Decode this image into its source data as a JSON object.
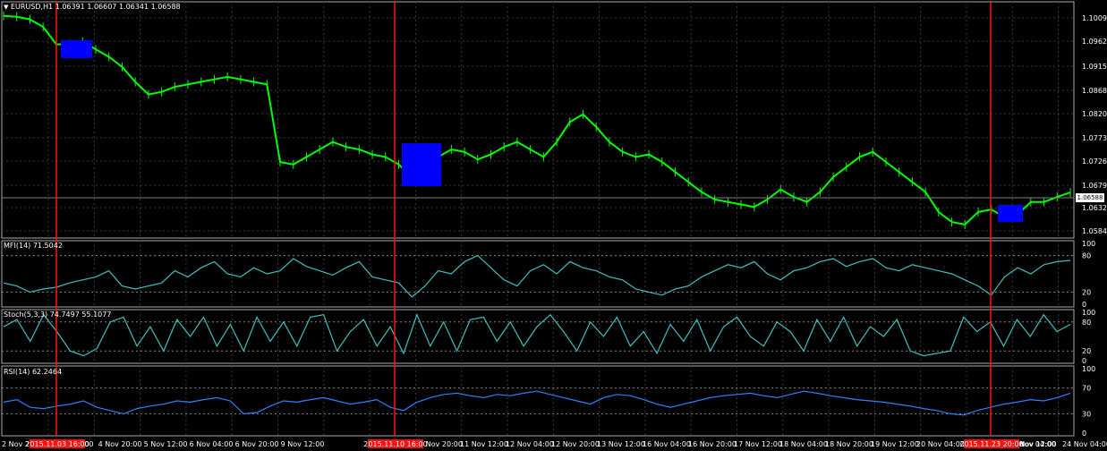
{
  "header": {
    "main": "EURUSD,H1  1.06391 1.06607 1.06341 1.06588",
    "mfi": "MFI(14) 71.5042",
    "stoch": "Stoch(5,3,3) 74.7497 55.1077",
    "rsi": "RSI(14) 62.2464"
  },
  "price_axis": [
    "1.10090",
    "1.09620",
    "1.09150",
    "1.08680",
    "1.08200",
    "1.07730",
    "1.07260",
    "1.06790",
    "1.06320",
    "1.05840"
  ],
  "current_price": "1.06588",
  "mfi_axis": [
    "100",
    "80",
    "20",
    "0"
  ],
  "stoch_axis": [
    "100",
    "80",
    "20",
    "0"
  ],
  "rsi_axis": [
    "100",
    "70",
    "30",
    "0"
  ],
  "time_axis": [
    "2 Nov 20",
    "4 Nov 04:00",
    "4 Nov 20:00",
    "5 Nov 12:00",
    "6 Nov 04:00",
    "6 Nov 20:00",
    "9 Nov 12:00",
    "10 Nov 20:00",
    "11 Nov 12:00",
    "12 Nov 04:00",
    "12 Nov 20:00",
    "13 Nov 12:00",
    "16 Nov 04:00",
    "16 Nov 20:00",
    "17 Nov 12:00",
    "18 Nov 04:00",
    "18 Nov 20:00",
    "19 Nov 12:00",
    "20 Nov 04:00",
    "20 Nov 20:00",
    "23 Nov 04:00",
    "Nov 12:00",
    "24 Nov 04:00"
  ],
  "markers": [
    {
      "label": "2015.11.03 16:00"
    },
    {
      "label": "2015.11.10 16:00"
    },
    {
      "label": "2015.11.23 20:00"
    }
  ],
  "colors": {
    "background": "#000000",
    "grid": "#3a3a3a",
    "candles": "#00ff00",
    "mfi": "#40c0c0",
    "stoch": "#40c0c0",
    "rsi": "#3080ff",
    "marker": "#ff1010",
    "box": "#0000ff"
  },
  "chart_data": [
    {
      "type": "line",
      "series": [
        {
          "values": [
            1.1012,
            1.101,
            1.1005,
            1.099,
            1.0955,
            1.0955,
            1.096,
            1.0945,
            1.093,
            1.091,
            1.088,
            1.0855,
            1.086,
            1.087,
            1.0875,
            1.088,
            1.0885,
            1.089,
            1.0885,
            1.088,
            1.0875,
            1.072,
            1.0715,
            1.073,
            1.0745,
            1.076,
            1.075,
            1.0745,
            1.0735,
            1.073,
            1.0715,
            1.069,
            1.07,
            1.073,
            1.0745,
            1.074,
            1.0725,
            1.0735,
            1.075,
            1.076,
            1.0745,
            1.073,
            1.076,
            1.08,
            1.0815,
            1.079,
            1.076,
            1.074,
            1.073,
            1.0735,
            1.072,
            1.07,
            1.068,
            1.066,
            1.0645,
            1.064,
            1.0635,
            1.063,
            1.0645,
            1.0665,
            1.065,
            1.064,
            1.066,
            1.069,
            1.071,
            1.073,
            1.074,
            1.072,
            1.07,
            1.068,
            1.066,
            1.062,
            1.06,
            1.0595,
            1.062,
            1.0625,
            1.061,
            1.0615,
            1.064,
            1.064,
            1.065,
            1.0659
          ]
        }
      ],
      "ylim": [
        1.0568,
        1.104
      ]
    },
    {
      "type": "line",
      "series": [
        {
          "values": [
            35,
            30,
            20,
            25,
            28,
            35,
            40,
            45,
            55,
            30,
            25,
            30,
            35,
            55,
            45,
            60,
            70,
            50,
            45,
            60,
            50,
            55,
            75,
            62,
            55,
            48,
            60,
            70,
            45,
            40,
            35,
            12,
            30,
            55,
            50,
            70,
            80,
            60,
            40,
            30,
            55,
            65,
            50,
            70,
            60,
            55,
            45,
            40,
            25,
            20,
            15,
            25,
            30,
            45,
            55,
            65,
            60,
            70,
            50,
            40,
            55,
            60,
            70,
            75,
            62,
            70,
            75,
            60,
            55,
            65,
            60,
            55,
            50,
            40,
            30,
            15,
            45,
            60,
            50,
            65,
            70,
            72
          ]
        }
      ],
      "ylim": [
        0,
        100
      ]
    },
    {
      "type": "line",
      "series": [
        {
          "values": [
            70,
            85,
            40,
            95,
            60,
            20,
            10,
            25,
            80,
            90,
            30,
            70,
            20,
            85,
            50,
            90,
            30,
            75,
            20,
            90,
            40,
            80,
            30,
            90,
            95,
            20,
            60,
            85,
            30,
            70,
            15,
            95,
            30,
            80,
            20,
            85,
            90,
            40,
            80,
            30,
            70,
            95,
            60,
            20,
            80,
            50,
            90,
            30,
            60,
            15,
            75,
            40,
            85,
            20,
            70,
            90,
            50,
            30,
            80,
            60,
            20,
            85,
            40,
            90,
            30,
            70,
            50,
            85,
            20,
            10,
            15,
            20,
            90,
            60,
            80,
            30,
            85,
            50,
            95,
            60,
            75
          ]
        }
      ],
      "ylim": [
        0,
        100
      ]
    },
    {
      "type": "line",
      "series": [
        {
          "values": [
            48,
            52,
            40,
            38,
            42,
            45,
            50,
            40,
            35,
            30,
            38,
            42,
            45,
            50,
            48,
            52,
            55,
            50,
            30,
            32,
            42,
            50,
            48,
            52,
            55,
            50,
            45,
            48,
            52,
            40,
            35,
            48,
            55,
            60,
            62,
            58,
            55,
            60,
            58,
            62,
            65,
            60,
            55,
            50,
            45,
            55,
            60,
            58,
            52,
            45,
            40,
            45,
            50,
            55,
            58,
            60,
            62,
            58,
            55,
            60,
            65,
            62,
            58,
            55,
            52,
            50,
            48,
            45,
            42,
            38,
            35,
            30,
            28,
            35,
            40,
            45,
            48,
            52,
            50,
            55,
            62
          ]
        }
      ],
      "ylim": [
        0,
        100
      ]
    }
  ]
}
